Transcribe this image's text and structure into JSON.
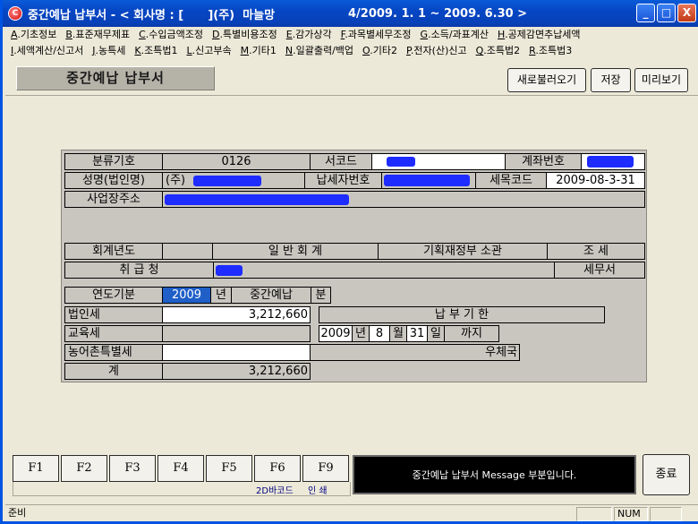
{
  "window": {
    "title_left": "중간예납 납부서 - < 회사명 : [      ](주)  마늘망",
    "title_period": "4/2009. 1. 1 ~ 2009. 6.30 >",
    "minimize": "_",
    "maximize": "□",
    "close": "X",
    "app_icon": "C"
  },
  "menu": {
    "row1": [
      {
        "key": "A",
        "label": ".기초정보"
      },
      {
        "key": "B",
        "label": ".표준재무제표"
      },
      {
        "key": "C",
        "label": ".수입금액조정"
      },
      {
        "key": "D",
        "label": ".특별비용조정"
      },
      {
        "key": "E",
        "label": ".감가상각"
      },
      {
        "key": "F",
        "label": ".과목별세무조정"
      },
      {
        "key": "G",
        "label": ".소득/과표계산"
      },
      {
        "key": "H",
        "label": ".공제감면추납세액"
      }
    ],
    "row2": [
      {
        "key": "I",
        "label": ".세액계산/신고서"
      },
      {
        "key": "J",
        "label": ".농특세"
      },
      {
        "key": "K",
        "label": ".조특법1"
      },
      {
        "key": "L",
        "label": ".신고부속"
      },
      {
        "key": "M",
        "label": ".기타1"
      },
      {
        "key": "N",
        "label": ".일괄출력/백업"
      },
      {
        "key": "O",
        "label": ".기타2"
      },
      {
        "key": "P",
        "label": ".전자(산)신고"
      },
      {
        "key": "Q",
        "label": ".조특법2"
      },
      {
        "key": "R",
        "label": ".조특법3"
      }
    ]
  },
  "page_title": "중간예납 납부서",
  "toolbar": {
    "reload": "새로불러오기",
    "save": "저장",
    "preview": "미리보기"
  },
  "form": {
    "classification_label": "분류기호",
    "classification_value": "0126",
    "office_code_label": "서코드",
    "account_no_label": "계좌번호",
    "name_label": "성명(법인명)",
    "name_value": "(주)",
    "taxpayer_no_label": "납세자번호",
    "tax_item_code_label": "세목코드",
    "tax_item_code_value": "2009-08-3-31",
    "business_addr_label": "사업장주소",
    "fiscal_year_label": "회계년도",
    "general_account_label": "일 반 회 계",
    "ministry_label": "기획재정부 소관",
    "tax_label": "조     세",
    "handler_label": "취     급     청",
    "tax_office_label": "세무서",
    "year_label": "연도기분",
    "year_value": "2009",
    "year_unit": "년",
    "interim_label": "중간예납",
    "portion_unit": "분",
    "corp_tax_label": "법인세",
    "corp_tax_value": "3,212,660",
    "due_label": "납 부 기 한",
    "edu_tax_label": "교육세",
    "due_year": "2009",
    "due_year_unit": "년",
    "due_month": "8",
    "due_month_unit": "월",
    "due_day": "31",
    "due_day_unit": "일",
    "due_until": "까지",
    "rural_tax_label": "농어촌특별세",
    "post_office_label": "우체국",
    "total_label": "계",
    "total_value": "3,212,660"
  },
  "fkeys": [
    "F1",
    "F2",
    "F3",
    "F4",
    "F5",
    "F6",
    "F9"
  ],
  "fkey_labels": {
    "f6": "2D바코드",
    "f9": "인  쇄"
  },
  "message": "중간예납 납부서 Message 부분입니다.",
  "close_button": "종료",
  "status": {
    "left": "준비",
    "num": "NUM"
  }
}
